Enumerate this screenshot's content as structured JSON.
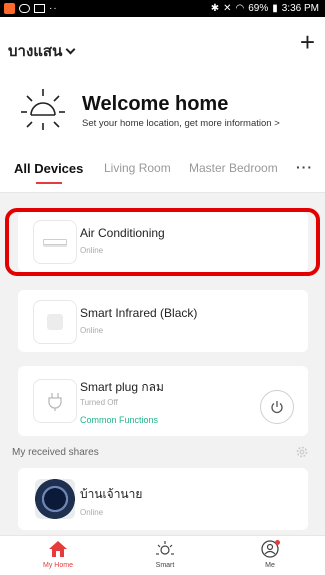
{
  "status_bar": {
    "dots": "··",
    "right_text": "69%",
    "time": "3:36 PM"
  },
  "header": {
    "home_name": "บางแสน",
    "add_symbol": "+"
  },
  "welcome": {
    "title": "Welcome home",
    "subtitle": "Set your home location, get more information >"
  },
  "tabs": {
    "items": [
      {
        "label": "All Devices",
        "active": true
      },
      {
        "label": "Living Room",
        "active": false
      },
      {
        "label": "Master Bedroom",
        "active": false
      }
    ],
    "more": "···"
  },
  "devices": [
    {
      "name": "Air Conditioning",
      "status": "Online",
      "icon": "air-conditioner-icon"
    },
    {
      "name": "Smart Infrared (Black)",
      "status": "Online",
      "icon": "infrared-remote-icon"
    },
    {
      "name": "Smart plug กลม",
      "status": "Turned Off",
      "link": "Common Functions",
      "icon": "plug-icon"
    }
  ],
  "shares": {
    "title": "My received shares",
    "items": [
      {
        "name": "บ้านเจ้านาย",
        "status": "Online"
      }
    ]
  },
  "bottom_nav": [
    {
      "label": "My Home",
      "icon": "home-icon",
      "active": true
    },
    {
      "label": "Smart",
      "icon": "sun-icon",
      "active": false
    },
    {
      "label": "Me",
      "icon": "profile-icon",
      "active": false
    }
  ],
  "colors": {
    "accent": "#e63b3b",
    "link": "#23b58a",
    "highlight": "#e30000"
  }
}
